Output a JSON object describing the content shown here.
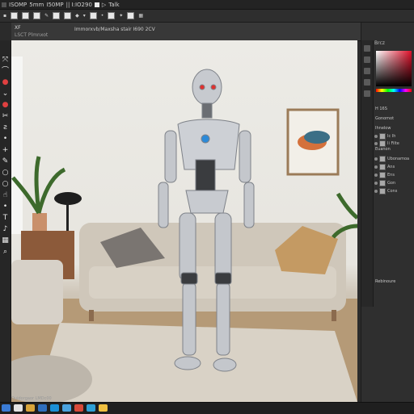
{
  "menubar": {
    "items": [
      "ISOMP",
      "5mm",
      "I50MP",
      "|| I:IO290",
      "Talk"
    ]
  },
  "options_bar": {},
  "document_tab": {
    "title": "XF",
    "subtitle": "LSCT Plmnxot",
    "filename": "Immorxvb/Maxsha stair I690 2CV"
  },
  "tools": [
    {
      "icon": "move-icon",
      "glyph": "⤧",
      "red": false
    },
    {
      "icon": "lasso-icon",
      "glyph": "⌒",
      "red": false
    },
    {
      "icon": "marker-icon",
      "glyph": "●",
      "red": true
    },
    {
      "icon": "chevron-down-icon",
      "glyph": "⌄",
      "red": false
    },
    {
      "icon": "marker-icon",
      "glyph": "●",
      "red": true
    },
    {
      "icon": "scissors-icon",
      "glyph": "✂",
      "red": false
    },
    {
      "icon": "brush-icon",
      "glyph": "ƨ",
      "red": false
    },
    {
      "icon": "dot-icon",
      "glyph": "•",
      "red": false
    },
    {
      "icon": "plus-icon",
      "glyph": "+",
      "red": false
    },
    {
      "icon": "pen-icon",
      "glyph": "✎",
      "red": false
    },
    {
      "icon": "ellipse-icon",
      "glyph": "○",
      "red": false
    },
    {
      "icon": "ellipse-icon",
      "glyph": "○",
      "red": false
    },
    {
      "icon": "hand-icon",
      "glyph": "☝",
      "red": false
    },
    {
      "icon": "dot-icon",
      "glyph": "•",
      "red": false
    },
    {
      "icon": "text-icon",
      "glyph": "T",
      "red": false
    },
    {
      "icon": "note-icon",
      "glyph": "♪",
      "red": false
    },
    {
      "icon": "grid-icon",
      "glyph": "▦",
      "red": false
    },
    {
      "icon": "zoom-icon",
      "glyph": "⌕",
      "red": false
    }
  ],
  "right_panel": {
    "header": "Brcz",
    "labels": [
      "H 16S",
      "Gonomot",
      "Ihnelow",
      "Euanon",
      "Rebinoure"
    ],
    "layers": [
      "Ic Ih",
      "Ii Filte",
      "Ubonamoa",
      "Ans",
      "Ens",
      "Gon",
      "Cons"
    ]
  },
  "status": {
    "text": "Quidorgaor LMDc00"
  }
}
